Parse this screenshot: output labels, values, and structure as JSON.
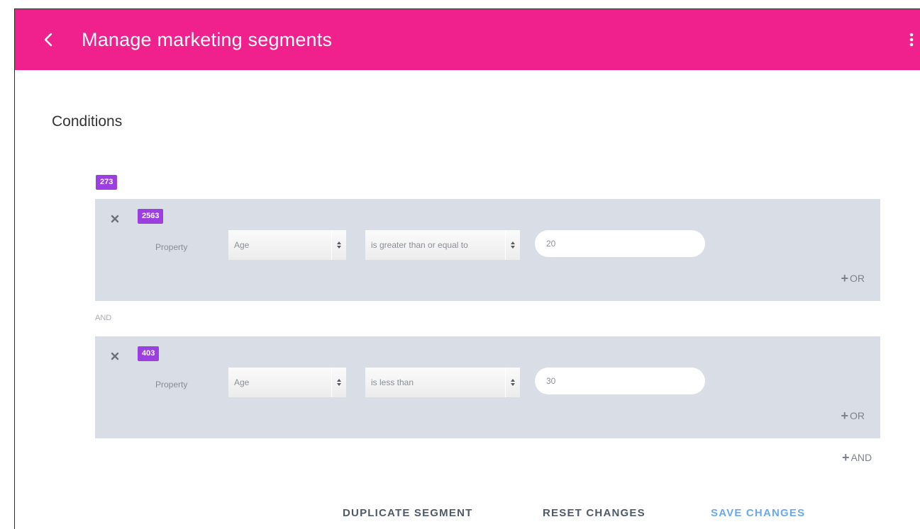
{
  "appbar": {
    "title": "Manage marketing segments",
    "back_icon": "chevron-left-icon",
    "more_icon": "more-vert-icon",
    "color": "#f0208c"
  },
  "conditions": {
    "heading": "Conditions",
    "root_count": "273",
    "join_label": "AND",
    "add_and_label": "AND",
    "groups": [
      {
        "count": "2563",
        "property_label": "Property",
        "property_value": "Age",
        "operator_value": "is greater than or equal to",
        "value": "20",
        "add_or_label": "OR"
      },
      {
        "count": "403",
        "property_label": "Property",
        "property_value": "Age",
        "operator_value": "is less than",
        "value": "30",
        "add_or_label": "OR"
      }
    ]
  },
  "actions": {
    "duplicate": "DUPLICATE SEGMENT",
    "reset": "RESET CHANGES",
    "save": "SAVE CHANGES"
  },
  "colors": {
    "accent": "#f0208c",
    "badge": "#9b3fe0",
    "group_bg": "#d9dde6",
    "action_muted": "#4f5a69",
    "action_primary": "#6aa8f0"
  }
}
